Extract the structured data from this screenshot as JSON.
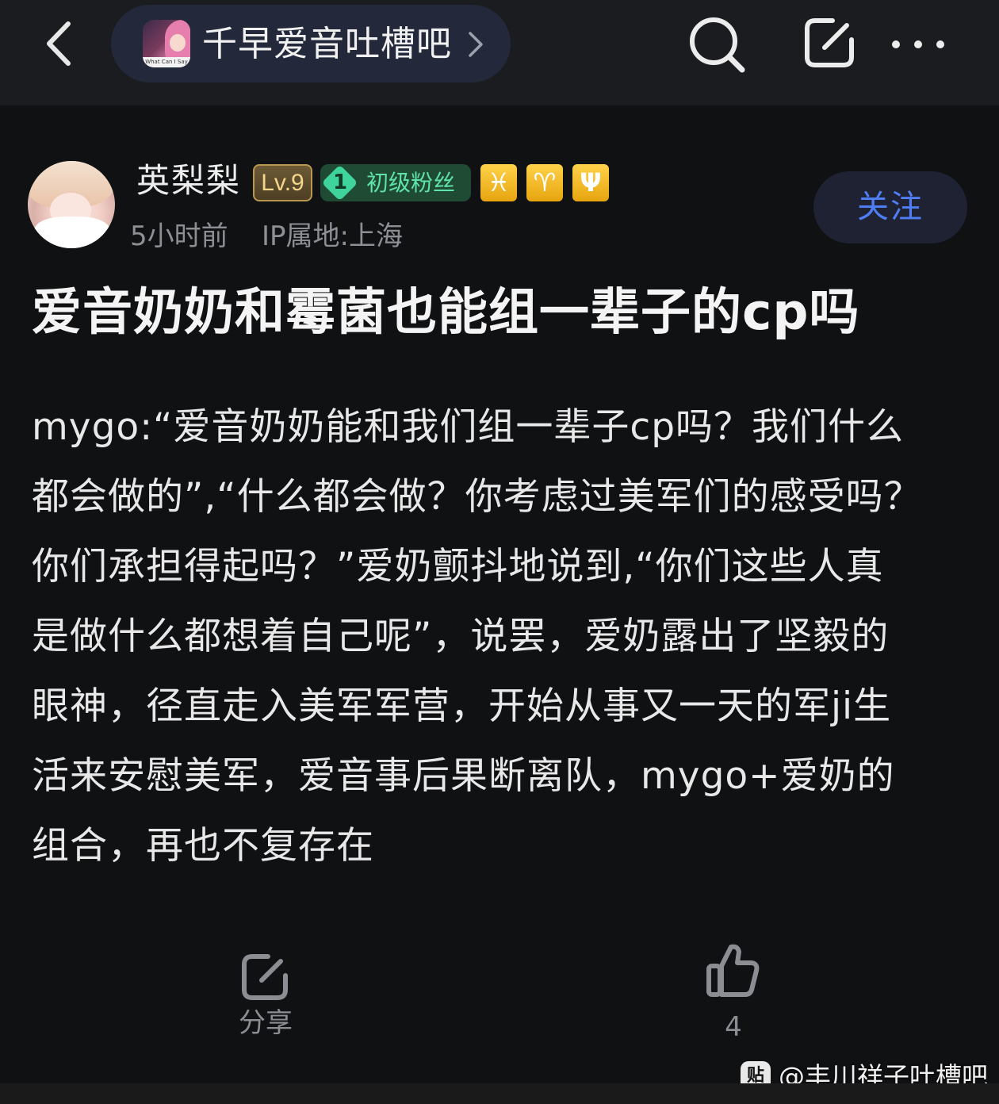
{
  "header": {
    "forum_name": "千早爱音吐槽吧",
    "forum_avatar_caption": "What Can I Say",
    "icons": [
      "back-icon",
      "chevron-right-icon",
      "search-icon",
      "edit-icon",
      "more-icon"
    ]
  },
  "author": {
    "name": "英梨梨",
    "level": "Lv.9",
    "fan_level": "1",
    "fan_title": "初级粉丝",
    "zodiac_badges": [
      "♓",
      "♈",
      "Ψ"
    ],
    "time": "5小时前",
    "ip": "IP属地:上海",
    "follow_label": "关注"
  },
  "post": {
    "title": "爱音奶奶和霉菌也能组一辈子的cp吗",
    "body_lines": [
      "mygo:“爱音奶奶能和我们组一辈子cp吗？我们什么",
      "都会做的”,“什么都会做？你考虑过美军们的感受吗？",
      "你们承担得起吗？”爱奶颤抖地说到,“你们这些人真",
      "是做什么都想着自己呢”，说罢，爱奶露出了坚毅的",
      "眼神，径直走入美军军营，开始从事又一天的军ji生",
      "活来安慰美军，爱音事后果断离队，mygo+爱奶的",
      "组合，再也不复存在"
    ]
  },
  "actions": {
    "share_label": "分享",
    "like_count": "4"
  },
  "watermark": {
    "icon_text": "贴",
    "text": "@丰川祥子吐槽吧"
  },
  "colors": {
    "background": "#101113",
    "topbar": "#1b1c1f",
    "accent_blue": "#4f7ef4",
    "fan_green": "#5fe3a9",
    "level_gold": "#f3d68a",
    "muted_text": "#8d8f94"
  }
}
